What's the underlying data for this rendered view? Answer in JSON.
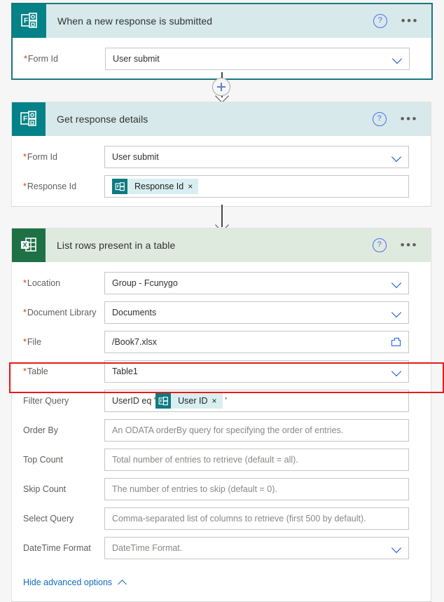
{
  "cards": [
    {
      "id": "trigger",
      "connector_icon": "microsoft-forms-icon",
      "title": "When a new response is submitted",
      "help_icon": "help-circle-icon",
      "menu_icon": "more-options-icon",
      "fields": [
        {
          "label": "Form Id",
          "required": true,
          "value": "User submit",
          "placeholder": "",
          "control": "dropdown"
        }
      ]
    },
    {
      "id": "get-response-details",
      "connector_icon": "microsoft-forms-icon",
      "title": "Get response details",
      "help_icon": "help-circle-icon",
      "menu_icon": "more-options-icon",
      "fields": [
        {
          "label": "Form Id",
          "required": true,
          "value": "User submit",
          "placeholder": "",
          "control": "dropdown"
        },
        {
          "label": "Response Id",
          "required": true,
          "value": "",
          "placeholder": "",
          "control": "token",
          "tokens": [
            {
              "type": "token",
              "label": "Response Id",
              "icon": "microsoft-forms-icon",
              "remove": "×"
            }
          ]
        }
      ]
    },
    {
      "id": "list-rows-present-in-a-table",
      "connector_icon": "excel-icon",
      "title": "List rows present in a table",
      "help_icon": "help-circle-icon",
      "menu_icon": "more-options-icon",
      "fields": [
        {
          "label": "Location",
          "required": true,
          "value": "Group - Fcunygo",
          "placeholder": "",
          "control": "dropdown"
        },
        {
          "label": "Document Library",
          "required": true,
          "value": "Documents",
          "placeholder": "",
          "control": "dropdown"
        },
        {
          "label": "File",
          "required": true,
          "value": "/Book7.xlsx",
          "placeholder": "",
          "control": "folder-picker"
        },
        {
          "label": "Table",
          "required": true,
          "value": "Table1",
          "placeholder": "",
          "control": "dropdown"
        },
        {
          "label": "Filter Query",
          "required": false,
          "value": "",
          "placeholder": "",
          "control": "token",
          "highlighted": true,
          "tokens": [
            {
              "type": "text",
              "label": "UserID eq '"
            },
            {
              "type": "token",
              "label": "User ID",
              "icon": "microsoft-forms-icon",
              "remove": "×"
            },
            {
              "type": "text",
              "label": "'"
            }
          ]
        },
        {
          "label": "Order By",
          "required": false,
          "value": "",
          "placeholder": "An ODATA orderBy query for specifying the order of entries.",
          "control": "text"
        },
        {
          "label": "Top Count",
          "required": false,
          "value": "",
          "placeholder": "Total number of entries to retrieve (default = all).",
          "control": "text"
        },
        {
          "label": "Skip Count",
          "required": false,
          "value": "",
          "placeholder": "The number of entries to skip (default = 0).",
          "control": "text"
        },
        {
          "label": "Select Query",
          "required": false,
          "value": "",
          "placeholder": "Comma-separated list of columns to retrieve (first 500 by default).",
          "control": "text"
        },
        {
          "label": "DateTime Format",
          "required": false,
          "value": "",
          "placeholder": "DateTime Format.",
          "control": "dropdown"
        }
      ],
      "advanced_options_label": "Hide advanced options",
      "advanced_options_icon": "chevron-up-icon"
    }
  ],
  "connectors": [
    {
      "id": "connector-1",
      "has_plus_button": true,
      "plus_icon": "plus-icon",
      "arrow_icon": "arrow-down-icon"
    },
    {
      "id": "connector-2",
      "has_plus_button": false,
      "arrow_icon": "arrow-down-icon"
    }
  ],
  "annotation": {
    "target": "Filter Query",
    "color": "#e41b1b"
  },
  "colors": {
    "forms_accent": "#048287",
    "forms_header": "#d7e9ea",
    "excel_accent": "#1e7145",
    "excel_header": "#dfeadf",
    "selected_border": "#1a777e",
    "link": "#0f6cbd",
    "required_asterisk": "#d83b01",
    "annotation": "#e41b1b",
    "canvas": "#f6f6f6"
  }
}
